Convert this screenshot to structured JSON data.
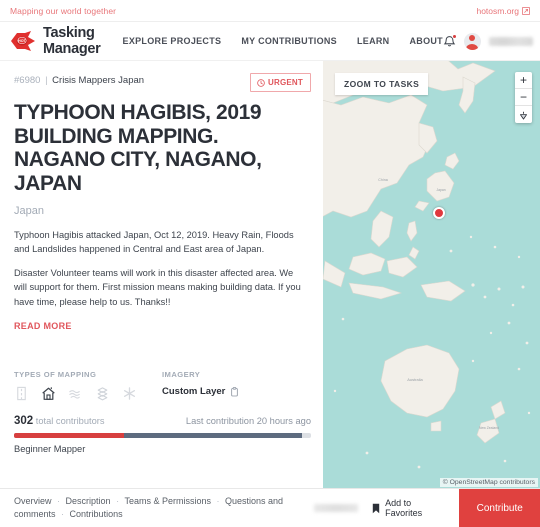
{
  "topbar": {
    "tagline": "Mapping our world together",
    "link_label": "hotosm.org",
    "external_icon": "external-link-icon"
  },
  "nav": {
    "brand": "Tasking Manager",
    "logo_text": "HOT",
    "links": [
      {
        "label": "EXPLORE PROJECTS"
      },
      {
        "label": "MY CONTRIBUTIONS"
      },
      {
        "label": "LEARN"
      },
      {
        "label": "ABOUT"
      }
    ],
    "notification_icon": "bell-icon",
    "avatar_icon": "user-avatar-icon",
    "chevron": "⌄"
  },
  "project": {
    "id": "#6980",
    "separator": "|",
    "organisation": "Crisis Mappers Japan",
    "badge": "URGENT",
    "badge_icon": "clock-icon",
    "title": "TYPHOON HAGIBIS, 2019 BUILDING MAPPING. NAGANO CITY, NAGANO, JAPAN",
    "country": "Japan",
    "description_1": "Typhoon Hagibis attacked Japan, Oct 12, 2019. Heavy Rain, Floods and Landslides happened in Central and East area of Japan.",
    "description_2": "Disaster Volunteer teams will work in this disaster affected area. We will support for them. First mission means making building data. If you have time, please help to us. Thanks!!",
    "read_more": "READ MORE"
  },
  "stats": {
    "types_heading": "TYPES OF MAPPING",
    "imagery_heading": "IMAGERY",
    "mapping_types": [
      {
        "name": "roads-icon",
        "active": false
      },
      {
        "name": "buildings-icon",
        "active": true
      },
      {
        "name": "waterways-icon",
        "active": false
      },
      {
        "name": "land-use-icon",
        "active": false
      },
      {
        "name": "other-icon",
        "active": false
      }
    ],
    "imagery_value": "Custom Layer",
    "imagery_copy_icon": "copy-icon",
    "contributors_count": "302",
    "contributors_label": "total contributors",
    "last_contribution": "Last contribution 20 hours ago",
    "progress_mapped_pct": 37,
    "progress_validated_pct": 60,
    "level": "Beginner Mapper"
  },
  "map": {
    "zoom_to_tasks": "ZOOM TO TASKS",
    "zoom_in": "+",
    "zoom_out": "−",
    "locate_icon": "locate-icon",
    "marker_icon": "map-marker-icon",
    "attribution": "© OpenStreetMap contributors"
  },
  "footer": {
    "links": [
      {
        "label": "Overview"
      },
      {
        "label": "Description"
      },
      {
        "label": "Teams & Permissions"
      },
      {
        "label": "Questions and comments"
      },
      {
        "label": "Contributions"
      }
    ],
    "separator": "·",
    "favorite_label": "Add to Favorites",
    "favorite_icon": "bookmark-icon",
    "contribute_label": "Contribute"
  },
  "colors": {
    "brand_red": "#e0413f",
    "accent_red": "#d73f3f",
    "map_water": "#aadcd8",
    "map_land": "#f2efe9",
    "validated": "#5d6b7f"
  }
}
